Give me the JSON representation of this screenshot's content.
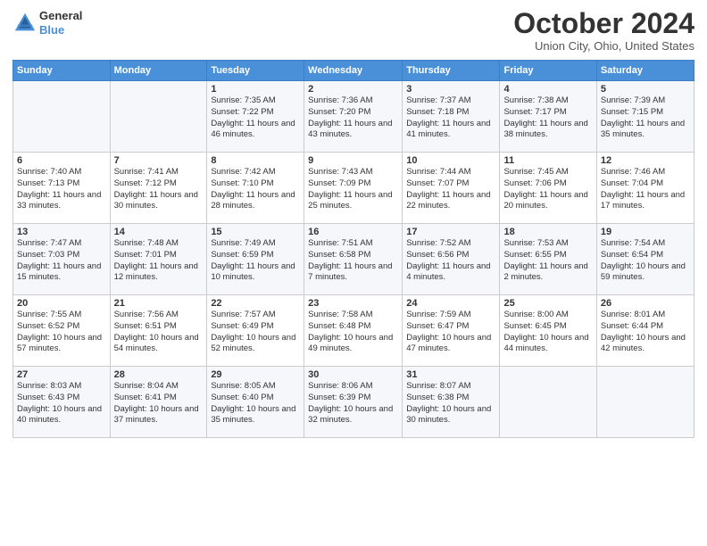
{
  "header": {
    "logo": {
      "line1": "General",
      "line2": "Blue"
    },
    "title": "October 2024",
    "subtitle": "Union City, Ohio, United States"
  },
  "weekdays": [
    "Sunday",
    "Monday",
    "Tuesday",
    "Wednesday",
    "Thursday",
    "Friday",
    "Saturday"
  ],
  "weeks": [
    [
      {
        "day": null
      },
      {
        "day": null
      },
      {
        "day": "1",
        "sunrise": "Sunrise: 7:35 AM",
        "sunset": "Sunset: 7:22 PM",
        "daylight": "Daylight: 11 hours and 46 minutes."
      },
      {
        "day": "2",
        "sunrise": "Sunrise: 7:36 AM",
        "sunset": "Sunset: 7:20 PM",
        "daylight": "Daylight: 11 hours and 43 minutes."
      },
      {
        "day": "3",
        "sunrise": "Sunrise: 7:37 AM",
        "sunset": "Sunset: 7:18 PM",
        "daylight": "Daylight: 11 hours and 41 minutes."
      },
      {
        "day": "4",
        "sunrise": "Sunrise: 7:38 AM",
        "sunset": "Sunset: 7:17 PM",
        "daylight": "Daylight: 11 hours and 38 minutes."
      },
      {
        "day": "5",
        "sunrise": "Sunrise: 7:39 AM",
        "sunset": "Sunset: 7:15 PM",
        "daylight": "Daylight: 11 hours and 35 minutes."
      }
    ],
    [
      {
        "day": "6",
        "sunrise": "Sunrise: 7:40 AM",
        "sunset": "Sunset: 7:13 PM",
        "daylight": "Daylight: 11 hours and 33 minutes."
      },
      {
        "day": "7",
        "sunrise": "Sunrise: 7:41 AM",
        "sunset": "Sunset: 7:12 PM",
        "daylight": "Daylight: 11 hours and 30 minutes."
      },
      {
        "day": "8",
        "sunrise": "Sunrise: 7:42 AM",
        "sunset": "Sunset: 7:10 PM",
        "daylight": "Daylight: 11 hours and 28 minutes."
      },
      {
        "day": "9",
        "sunrise": "Sunrise: 7:43 AM",
        "sunset": "Sunset: 7:09 PM",
        "daylight": "Daylight: 11 hours and 25 minutes."
      },
      {
        "day": "10",
        "sunrise": "Sunrise: 7:44 AM",
        "sunset": "Sunset: 7:07 PM",
        "daylight": "Daylight: 11 hours and 22 minutes."
      },
      {
        "day": "11",
        "sunrise": "Sunrise: 7:45 AM",
        "sunset": "Sunset: 7:06 PM",
        "daylight": "Daylight: 11 hours and 20 minutes."
      },
      {
        "day": "12",
        "sunrise": "Sunrise: 7:46 AM",
        "sunset": "Sunset: 7:04 PM",
        "daylight": "Daylight: 11 hours and 17 minutes."
      }
    ],
    [
      {
        "day": "13",
        "sunrise": "Sunrise: 7:47 AM",
        "sunset": "Sunset: 7:03 PM",
        "daylight": "Daylight: 11 hours and 15 minutes."
      },
      {
        "day": "14",
        "sunrise": "Sunrise: 7:48 AM",
        "sunset": "Sunset: 7:01 PM",
        "daylight": "Daylight: 11 hours and 12 minutes."
      },
      {
        "day": "15",
        "sunrise": "Sunrise: 7:49 AM",
        "sunset": "Sunset: 6:59 PM",
        "daylight": "Daylight: 11 hours and 10 minutes."
      },
      {
        "day": "16",
        "sunrise": "Sunrise: 7:51 AM",
        "sunset": "Sunset: 6:58 PM",
        "daylight": "Daylight: 11 hours and 7 minutes."
      },
      {
        "day": "17",
        "sunrise": "Sunrise: 7:52 AM",
        "sunset": "Sunset: 6:56 PM",
        "daylight": "Daylight: 11 hours and 4 minutes."
      },
      {
        "day": "18",
        "sunrise": "Sunrise: 7:53 AM",
        "sunset": "Sunset: 6:55 PM",
        "daylight": "Daylight: 11 hours and 2 minutes."
      },
      {
        "day": "19",
        "sunrise": "Sunrise: 7:54 AM",
        "sunset": "Sunset: 6:54 PM",
        "daylight": "Daylight: 10 hours and 59 minutes."
      }
    ],
    [
      {
        "day": "20",
        "sunrise": "Sunrise: 7:55 AM",
        "sunset": "Sunset: 6:52 PM",
        "daylight": "Daylight: 10 hours and 57 minutes."
      },
      {
        "day": "21",
        "sunrise": "Sunrise: 7:56 AM",
        "sunset": "Sunset: 6:51 PM",
        "daylight": "Daylight: 10 hours and 54 minutes."
      },
      {
        "day": "22",
        "sunrise": "Sunrise: 7:57 AM",
        "sunset": "Sunset: 6:49 PM",
        "daylight": "Daylight: 10 hours and 52 minutes."
      },
      {
        "day": "23",
        "sunrise": "Sunrise: 7:58 AM",
        "sunset": "Sunset: 6:48 PM",
        "daylight": "Daylight: 10 hours and 49 minutes."
      },
      {
        "day": "24",
        "sunrise": "Sunrise: 7:59 AM",
        "sunset": "Sunset: 6:47 PM",
        "daylight": "Daylight: 10 hours and 47 minutes."
      },
      {
        "day": "25",
        "sunrise": "Sunrise: 8:00 AM",
        "sunset": "Sunset: 6:45 PM",
        "daylight": "Daylight: 10 hours and 44 minutes."
      },
      {
        "day": "26",
        "sunrise": "Sunrise: 8:01 AM",
        "sunset": "Sunset: 6:44 PM",
        "daylight": "Daylight: 10 hours and 42 minutes."
      }
    ],
    [
      {
        "day": "27",
        "sunrise": "Sunrise: 8:03 AM",
        "sunset": "Sunset: 6:43 PM",
        "daylight": "Daylight: 10 hours and 40 minutes."
      },
      {
        "day": "28",
        "sunrise": "Sunrise: 8:04 AM",
        "sunset": "Sunset: 6:41 PM",
        "daylight": "Daylight: 10 hours and 37 minutes."
      },
      {
        "day": "29",
        "sunrise": "Sunrise: 8:05 AM",
        "sunset": "Sunset: 6:40 PM",
        "daylight": "Daylight: 10 hours and 35 minutes."
      },
      {
        "day": "30",
        "sunrise": "Sunrise: 8:06 AM",
        "sunset": "Sunset: 6:39 PM",
        "daylight": "Daylight: 10 hours and 32 minutes."
      },
      {
        "day": "31",
        "sunrise": "Sunrise: 8:07 AM",
        "sunset": "Sunset: 6:38 PM",
        "daylight": "Daylight: 10 hours and 30 minutes."
      },
      {
        "day": null
      },
      {
        "day": null
      }
    ]
  ]
}
